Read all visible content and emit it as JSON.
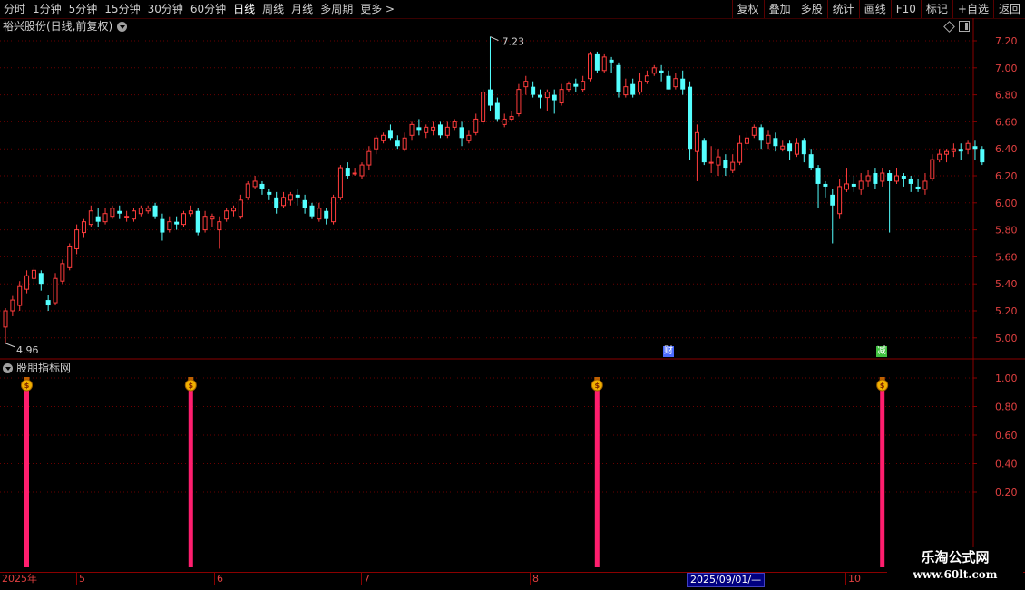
{
  "toolbar": {
    "periods": [
      "分时",
      "1分钟",
      "5分钟",
      "15分钟",
      "30分钟",
      "60分钟",
      "日线",
      "周线",
      "月线",
      "多周期",
      "更多 >"
    ],
    "active_period": "日线",
    "buttons": [
      "复权",
      "叠加",
      "多股",
      "统计",
      "画线",
      "F10",
      "标记",
      "+自选",
      "返回"
    ]
  },
  "chart_title": "裕兴股份(日线,前复权)",
  "indicator_title": "股朋指标网",
  "price_axis": [
    "7.20",
    "7.00",
    "6.80",
    "6.60",
    "6.40",
    "6.20",
    "6.00",
    "5.80",
    "5.60",
    "5.40",
    "5.20",
    "5.00"
  ],
  "indicator_axis": [
    "1.00",
    "0.80",
    "0.60",
    "0.40",
    "0.20"
  ],
  "high_label": "7.23",
  "low_label": "4.96",
  "event_markers": [
    {
      "label": "财",
      "color": "#4a6aff"
    },
    {
      "label": "减",
      "color": "#40c040"
    }
  ],
  "signal_icon": "money-bag-icon",
  "signals": [
    1,
    1,
    1,
    1
  ],
  "dates": {
    "labels": [
      "2025年",
      "5",
      "6",
      "7",
      "8",
      "10"
    ],
    "cursor": "2025/09/01/—"
  },
  "watermark": {
    "line1": "乐淘公式网",
    "line2": "www.60lt.com"
  },
  "colors": {
    "up": "#ff3c3c",
    "down": "#54ffff",
    "signal": "#ff1e6e",
    "grid": "#6a0000"
  },
  "chart_data": {
    "type": "candlestick",
    "title": "裕兴股份(日线,前复权)",
    "ylim": [
      4.9,
      7.3
    ],
    "candles": [
      [
        5.08,
        5.2,
        5.22,
        4.96
      ],
      [
        5.2,
        5.28,
        5.31,
        5.16
      ],
      [
        5.24,
        5.38,
        5.42,
        5.2
      ],
      [
        5.36,
        5.46,
        5.5,
        5.33
      ],
      [
        5.44,
        5.5,
        5.52,
        5.4
      ],
      [
        5.48,
        5.4,
        5.5,
        5.35
      ],
      [
        5.28,
        5.24,
        5.32,
        5.2
      ],
      [
        5.26,
        5.44,
        5.48,
        5.24
      ],
      [
        5.42,
        5.55,
        5.58,
        5.4
      ],
      [
        5.52,
        5.68,
        5.7,
        5.5
      ],
      [
        5.66,
        5.8,
        5.84,
        5.62
      ],
      [
        5.78,
        5.86,
        5.88,
        5.74
      ],
      [
        5.84,
        5.94,
        5.98,
        5.82
      ],
      [
        5.9,
        5.86,
        5.96,
        5.82
      ],
      [
        5.86,
        5.92,
        5.96,
        5.84
      ],
      [
        5.9,
        5.96,
        5.98,
        5.88
      ],
      [
        5.94,
        5.92,
        5.98,
        5.88
      ],
      [
        5.9,
        5.9,
        5.94,
        5.86
      ],
      [
        5.88,
        5.94,
        5.96,
        5.86
      ],
      [
        5.92,
        5.96,
        5.98,
        5.9
      ],
      [
        5.94,
        5.96,
        5.98,
        5.92
      ],
      [
        5.98,
        5.9,
        6.0,
        5.88
      ],
      [
        5.88,
        5.78,
        5.92,
        5.72
      ],
      [
        5.8,
        5.86,
        5.9,
        5.78
      ],
      [
        5.86,
        5.84,
        5.9,
        5.8
      ],
      [
        5.84,
        5.92,
        5.94,
        5.82
      ],
      [
        5.92,
        5.94,
        5.98,
        5.9
      ],
      [
        5.94,
        5.78,
        5.96,
        5.76
      ],
      [
        5.8,
        5.9,
        5.94,
        5.78
      ],
      [
        5.88,
        5.9,
        5.92,
        5.82
      ],
      [
        5.8,
        5.86,
        5.9,
        5.66
      ],
      [
        5.88,
        5.94,
        5.96,
        5.86
      ],
      [
        5.94,
        5.96,
        5.98,
        5.9
      ],
      [
        5.9,
        6.02,
        6.06,
        5.88
      ],
      [
        6.04,
        6.14,
        6.16,
        6.02
      ],
      [
        6.12,
        6.16,
        6.2,
        6.1
      ],
      [
        6.14,
        6.1,
        6.16,
        6.06
      ],
      [
        6.08,
        6.06,
        6.1,
        6.02
      ],
      [
        6.04,
        5.96,
        6.08,
        5.92
      ],
      [
        5.98,
        6.04,
        6.08,
        5.96
      ],
      [
        6.02,
        6.06,
        6.08,
        5.98
      ],
      [
        6.06,
        6.04,
        6.1,
        5.98
      ],
      [
        6.02,
        5.96,
        6.06,
        5.92
      ],
      [
        5.98,
        5.9,
        6.0,
        5.88
      ],
      [
        5.88,
        5.96,
        6.0,
        5.86
      ],
      [
        5.94,
        5.88,
        5.96,
        5.84
      ],
      [
        5.86,
        6.04,
        6.06,
        5.84
      ],
      [
        6.04,
        6.26,
        6.28,
        6.02
      ],
      [
        6.26,
        6.2,
        6.3,
        6.18
      ],
      [
        6.22,
        6.22,
        6.26,
        6.2
      ],
      [
        6.2,
        6.28,
        6.3,
        6.18
      ],
      [
        6.28,
        6.38,
        6.42,
        6.24
      ],
      [
        6.4,
        6.48,
        6.5,
        6.36
      ],
      [
        6.46,
        6.5,
        6.52,
        6.44
      ],
      [
        6.54,
        6.48,
        6.58,
        6.46
      ],
      [
        6.46,
        6.42,
        6.5,
        6.4
      ],
      [
        6.4,
        6.48,
        6.52,
        6.38
      ],
      [
        6.5,
        6.58,
        6.6,
        6.46
      ],
      [
        6.56,
        6.54,
        6.62,
        6.5
      ],
      [
        6.52,
        6.56,
        6.58,
        6.48
      ],
      [
        6.54,
        6.56,
        6.6,
        6.5
      ],
      [
        6.58,
        6.5,
        6.6,
        6.48
      ],
      [
        6.5,
        6.56,
        6.6,
        6.48
      ],
      [
        6.56,
        6.6,
        6.62,
        6.54
      ],
      [
        6.56,
        6.48,
        6.6,
        6.42
      ],
      [
        6.46,
        6.5,
        6.54,
        6.44
      ],
      [
        6.52,
        6.62,
        6.66,
        6.5
      ],
      [
        6.6,
        6.82,
        6.84,
        6.58
      ],
      [
        6.84,
        6.72,
        7.23,
        6.68
      ],
      [
        6.74,
        6.62,
        6.78,
        6.6
      ],
      [
        6.58,
        6.62,
        6.66,
        6.56
      ],
      [
        6.62,
        6.64,
        6.68,
        6.6
      ],
      [
        6.66,
        6.84,
        6.88,
        6.64
      ],
      [
        6.86,
        6.9,
        6.94,
        6.8
      ],
      [
        6.86,
        6.8,
        6.9,
        6.78
      ],
      [
        6.8,
        6.78,
        6.84,
        6.7
      ],
      [
        6.78,
        6.82,
        6.84,
        6.68
      ],
      [
        6.8,
        6.76,
        6.84,
        6.66
      ],
      [
        6.74,
        6.84,
        6.88,
        6.72
      ],
      [
        6.84,
        6.88,
        6.9,
        6.82
      ],
      [
        6.88,
        6.86,
        6.92,
        6.82
      ],
      [
        6.84,
        6.9,
        6.94,
        6.82
      ],
      [
        6.92,
        7.1,
        7.12,
        6.9
      ],
      [
        7.1,
        6.98,
        7.12,
        6.96
      ],
      [
        6.98,
        7.08,
        7.1,
        6.96
      ],
      [
        7.06,
        7.04,
        7.08,
        6.96
      ],
      [
        7.02,
        6.82,
        7.04,
        6.78
      ],
      [
        6.8,
        6.86,
        6.92,
        6.78
      ],
      [
        6.88,
        6.8,
        6.92,
        6.78
      ],
      [
        6.82,
        6.9,
        6.96,
        6.8
      ],
      [
        6.9,
        6.94,
        6.98,
        6.88
      ],
      [
        6.96,
        7.0,
        7.02,
        6.94
      ],
      [
        6.98,
        6.96,
        7.02,
        6.9
      ],
      [
        6.94,
        6.84,
        6.98,
        6.84
      ],
      [
        6.86,
        6.92,
        6.96,
        6.84
      ],
      [
        6.92,
        6.84,
        6.98,
        6.8
      ],
      [
        6.86,
        6.4,
        6.9,
        6.32
      ],
      [
        6.38,
        6.52,
        6.58,
        6.16
      ],
      [
        6.46,
        6.3,
        6.48,
        6.28
      ],
      [
        6.3,
        6.3,
        6.42,
        6.22
      ],
      [
        6.28,
        6.34,
        6.4,
        6.2
      ],
      [
        6.32,
        6.26,
        6.36,
        6.2
      ],
      [
        6.24,
        6.3,
        6.36,
        6.22
      ],
      [
        6.3,
        6.44,
        6.5,
        6.28
      ],
      [
        6.44,
        6.48,
        6.52,
        6.4
      ],
      [
        6.5,
        6.56,
        6.58,
        6.48
      ],
      [
        6.56,
        6.46,
        6.58,
        6.4
      ],
      [
        6.44,
        6.5,
        6.54,
        6.4
      ],
      [
        6.48,
        6.42,
        6.52,
        6.38
      ],
      [
        6.4,
        6.42,
        6.46,
        6.38
      ],
      [
        6.44,
        6.38,
        6.46,
        6.32
      ],
      [
        6.36,
        6.44,
        6.48,
        6.34
      ],
      [
        6.46,
        6.36,
        6.48,
        6.3
      ],
      [
        6.36,
        6.26,
        6.4,
        6.24
      ],
      [
        6.26,
        6.14,
        6.28,
        5.96
      ],
      [
        6.14,
        6.12,
        6.16,
        6.04
      ],
      [
        6.06,
        5.98,
        6.1,
        5.7
      ],
      [
        5.92,
        6.12,
        6.18,
        5.88
      ],
      [
        6.1,
        6.14,
        6.26,
        6.08
      ],
      [
        6.14,
        6.12,
        6.2,
        6.08
      ],
      [
        6.1,
        6.16,
        6.22,
        6.06
      ],
      [
        6.16,
        6.2,
        6.24,
        6.12
      ],
      [
        6.22,
        6.14,
        6.26,
        6.1
      ],
      [
        6.16,
        6.22,
        6.26,
        6.12
      ],
      [
        6.22,
        6.16,
        6.24,
        5.78
      ],
      [
        6.16,
        6.2,
        6.26,
        6.14
      ],
      [
        6.2,
        6.18,
        6.22,
        6.12
      ],
      [
        6.18,
        6.14,
        6.2,
        6.08
      ],
      [
        6.12,
        6.1,
        6.18,
        6.08
      ],
      [
        6.1,
        6.16,
        6.22,
        6.06
      ],
      [
        6.18,
        6.32,
        6.36,
        6.16
      ],
      [
        6.32,
        6.36,
        6.4,
        6.3
      ],
      [
        6.36,
        6.38,
        6.4,
        6.3
      ],
      [
        6.38,
        6.4,
        6.44,
        6.34
      ],
      [
        6.4,
        6.38,
        6.44,
        6.32
      ],
      [
        6.4,
        6.44,
        6.46,
        6.36
      ],
      [
        6.42,
        6.4,
        6.46,
        6.32
      ],
      [
        6.4,
        6.3,
        6.42,
        6.28
      ]
    ],
    "signals_at_candle_index": [
      4,
      27,
      84,
      124
    ]
  }
}
